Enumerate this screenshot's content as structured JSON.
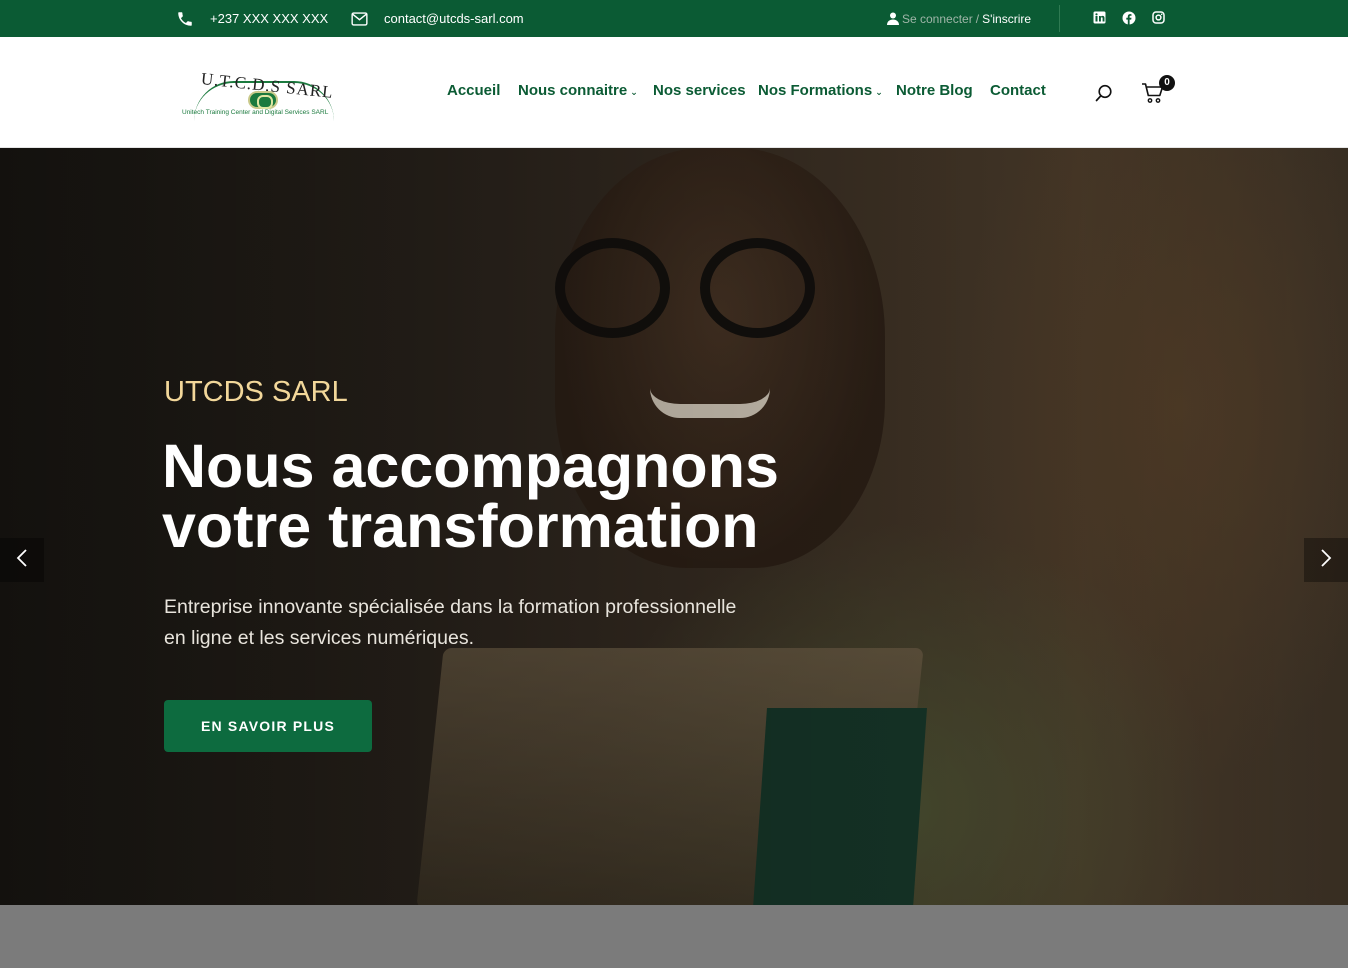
{
  "colors": {
    "brand_green": "#0b5b34",
    "button_green": "#0d6b3f",
    "kicker_gold": "#f2d79a"
  },
  "topbar": {
    "phone": "+237 XXX XXX XXX",
    "email": "contact@utcds-sarl.com",
    "login_label": "Se connecter",
    "separator": "/",
    "register_label": "S'inscrire",
    "social_icons": [
      "linkedin-icon",
      "facebook-icon",
      "instagram-icon"
    ]
  },
  "header": {
    "logo": {
      "name": "U.T.C.D.S SARL",
      "tagline": "Unitech Training Center and Digital Services SARL"
    },
    "nav": [
      {
        "label": "Accueil",
        "has_dropdown": false
      },
      {
        "label": "Nous connaitre",
        "has_dropdown": true
      },
      {
        "label": "Nos services",
        "has_dropdown": false
      },
      {
        "label": "Nos Formations",
        "has_dropdown": true
      },
      {
        "label": "Notre Blog",
        "has_dropdown": false
      },
      {
        "label": "Contact",
        "has_dropdown": false
      }
    ],
    "cart_count": "0"
  },
  "hero": {
    "kicker": "UTCDS SARL",
    "headline_line1": "Nous accompagnons",
    "headline_line2": "votre transformation",
    "description_line1": "Entreprise innovante spécialisée dans la formation professionnelle",
    "description_line2": "en ligne et les services numériques.",
    "cta_label": "EN SAVOIR PLUS"
  }
}
